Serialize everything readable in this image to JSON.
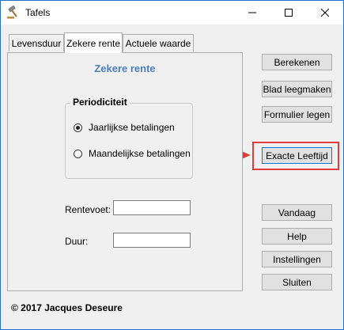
{
  "window": {
    "title": "Tafels",
    "controls": {
      "minimize": "minimize",
      "maximize": "maximize",
      "close": "close"
    }
  },
  "tabs": [
    {
      "label": "Levensduur",
      "active": false
    },
    {
      "label": "Zekere rente",
      "active": true
    },
    {
      "label": "Actuele waarde",
      "active": false
    }
  ],
  "panel": {
    "title": "Zekere rente",
    "group": {
      "legend": "Periodiciteit",
      "options": [
        {
          "label": "Jaarlijkse betalingen",
          "checked": true
        },
        {
          "label": "Maandelijkse betalingen",
          "checked": false
        }
      ]
    },
    "fields": {
      "rentevoet_label": "Rentevoet:",
      "rentevoet_value": "",
      "duur_label": "Duur:",
      "duur_value": ""
    }
  },
  "buttons": {
    "berekenen": "Berekenen",
    "blad_leegmaken": "Blad leegmaken",
    "formulier_legen": "Formulier legen",
    "exacte_leeftijd": "Exacte Leeftijd",
    "vandaag": "Vandaag",
    "help": "Help",
    "instellingen": "Instellingen",
    "sluiten": "Sluiten"
  },
  "footer": {
    "copyright": "© 2017 Jacques Deseure"
  },
  "colors": {
    "accent": "#4a7ebb",
    "annotation": "#e03c3c",
    "focus_border": "#0078d7",
    "window_border": "#1f6fd6"
  },
  "icons": [
    "gavel-icon",
    "minimize-icon",
    "maximize-icon",
    "close-icon",
    "arrow-right-icon"
  ]
}
